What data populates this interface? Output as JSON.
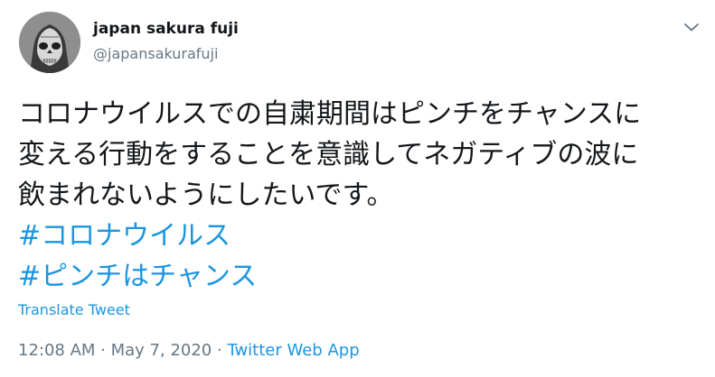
{
  "user": {
    "display_name": "japan sakura fuji",
    "handle": "@japansakurafuji",
    "avatar_icon": "skull-mask-avatar"
  },
  "tweet": {
    "lines": [
      "コロナウイルスでの自粛期間はピンチをチャンスに",
      "変える行動をすることを意識してネガティブの波に",
      "飲まれないようにしたいです。"
    ],
    "hashtags": [
      "#コロナウイルス",
      "#ピンチはチャンス"
    ],
    "translate_label": "Translate Tweet",
    "time": "12:08 AM",
    "separator": " · ",
    "date": "May 7, 2020",
    "source": "Twitter Web App"
  },
  "colors": {
    "link": "#1b95e0",
    "secondary_text": "#657786",
    "primary_text": "#14171a"
  }
}
